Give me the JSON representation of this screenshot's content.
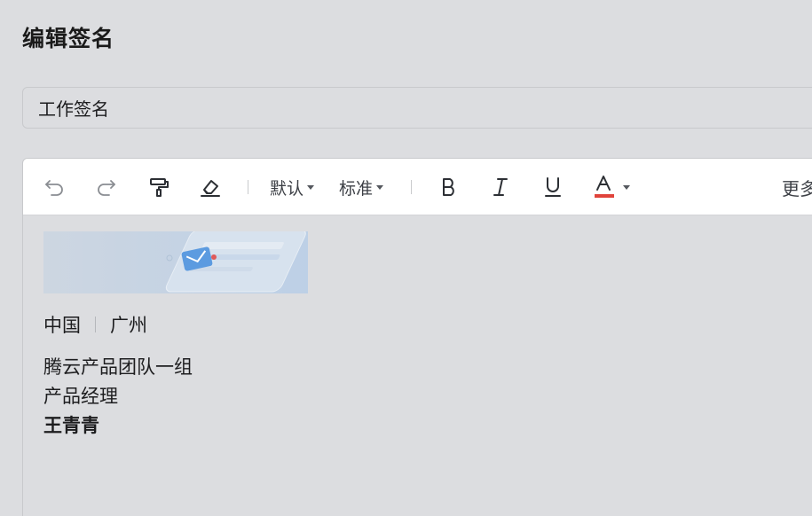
{
  "page": {
    "title": "编辑签名"
  },
  "signature_name": {
    "value": "工作签名"
  },
  "toolbar": {
    "undo_icon": "undo-icon",
    "redo_icon": "redo-icon",
    "format_painter_icon": "format-painter-icon",
    "eraser_icon": "eraser-icon",
    "font_family": "默认",
    "font_size": "标准",
    "bold_icon": "bold-icon",
    "italic_icon": "italic-icon",
    "underline_icon": "underline-icon",
    "font_color_icon": "font-color-icon",
    "font_color": "#e0433b",
    "more_label": "更多"
  },
  "signature": {
    "country": "中国",
    "city": "广州",
    "lines": [
      "腾云产品团队一组",
      "产品经理"
    ],
    "name": "王青青"
  }
}
